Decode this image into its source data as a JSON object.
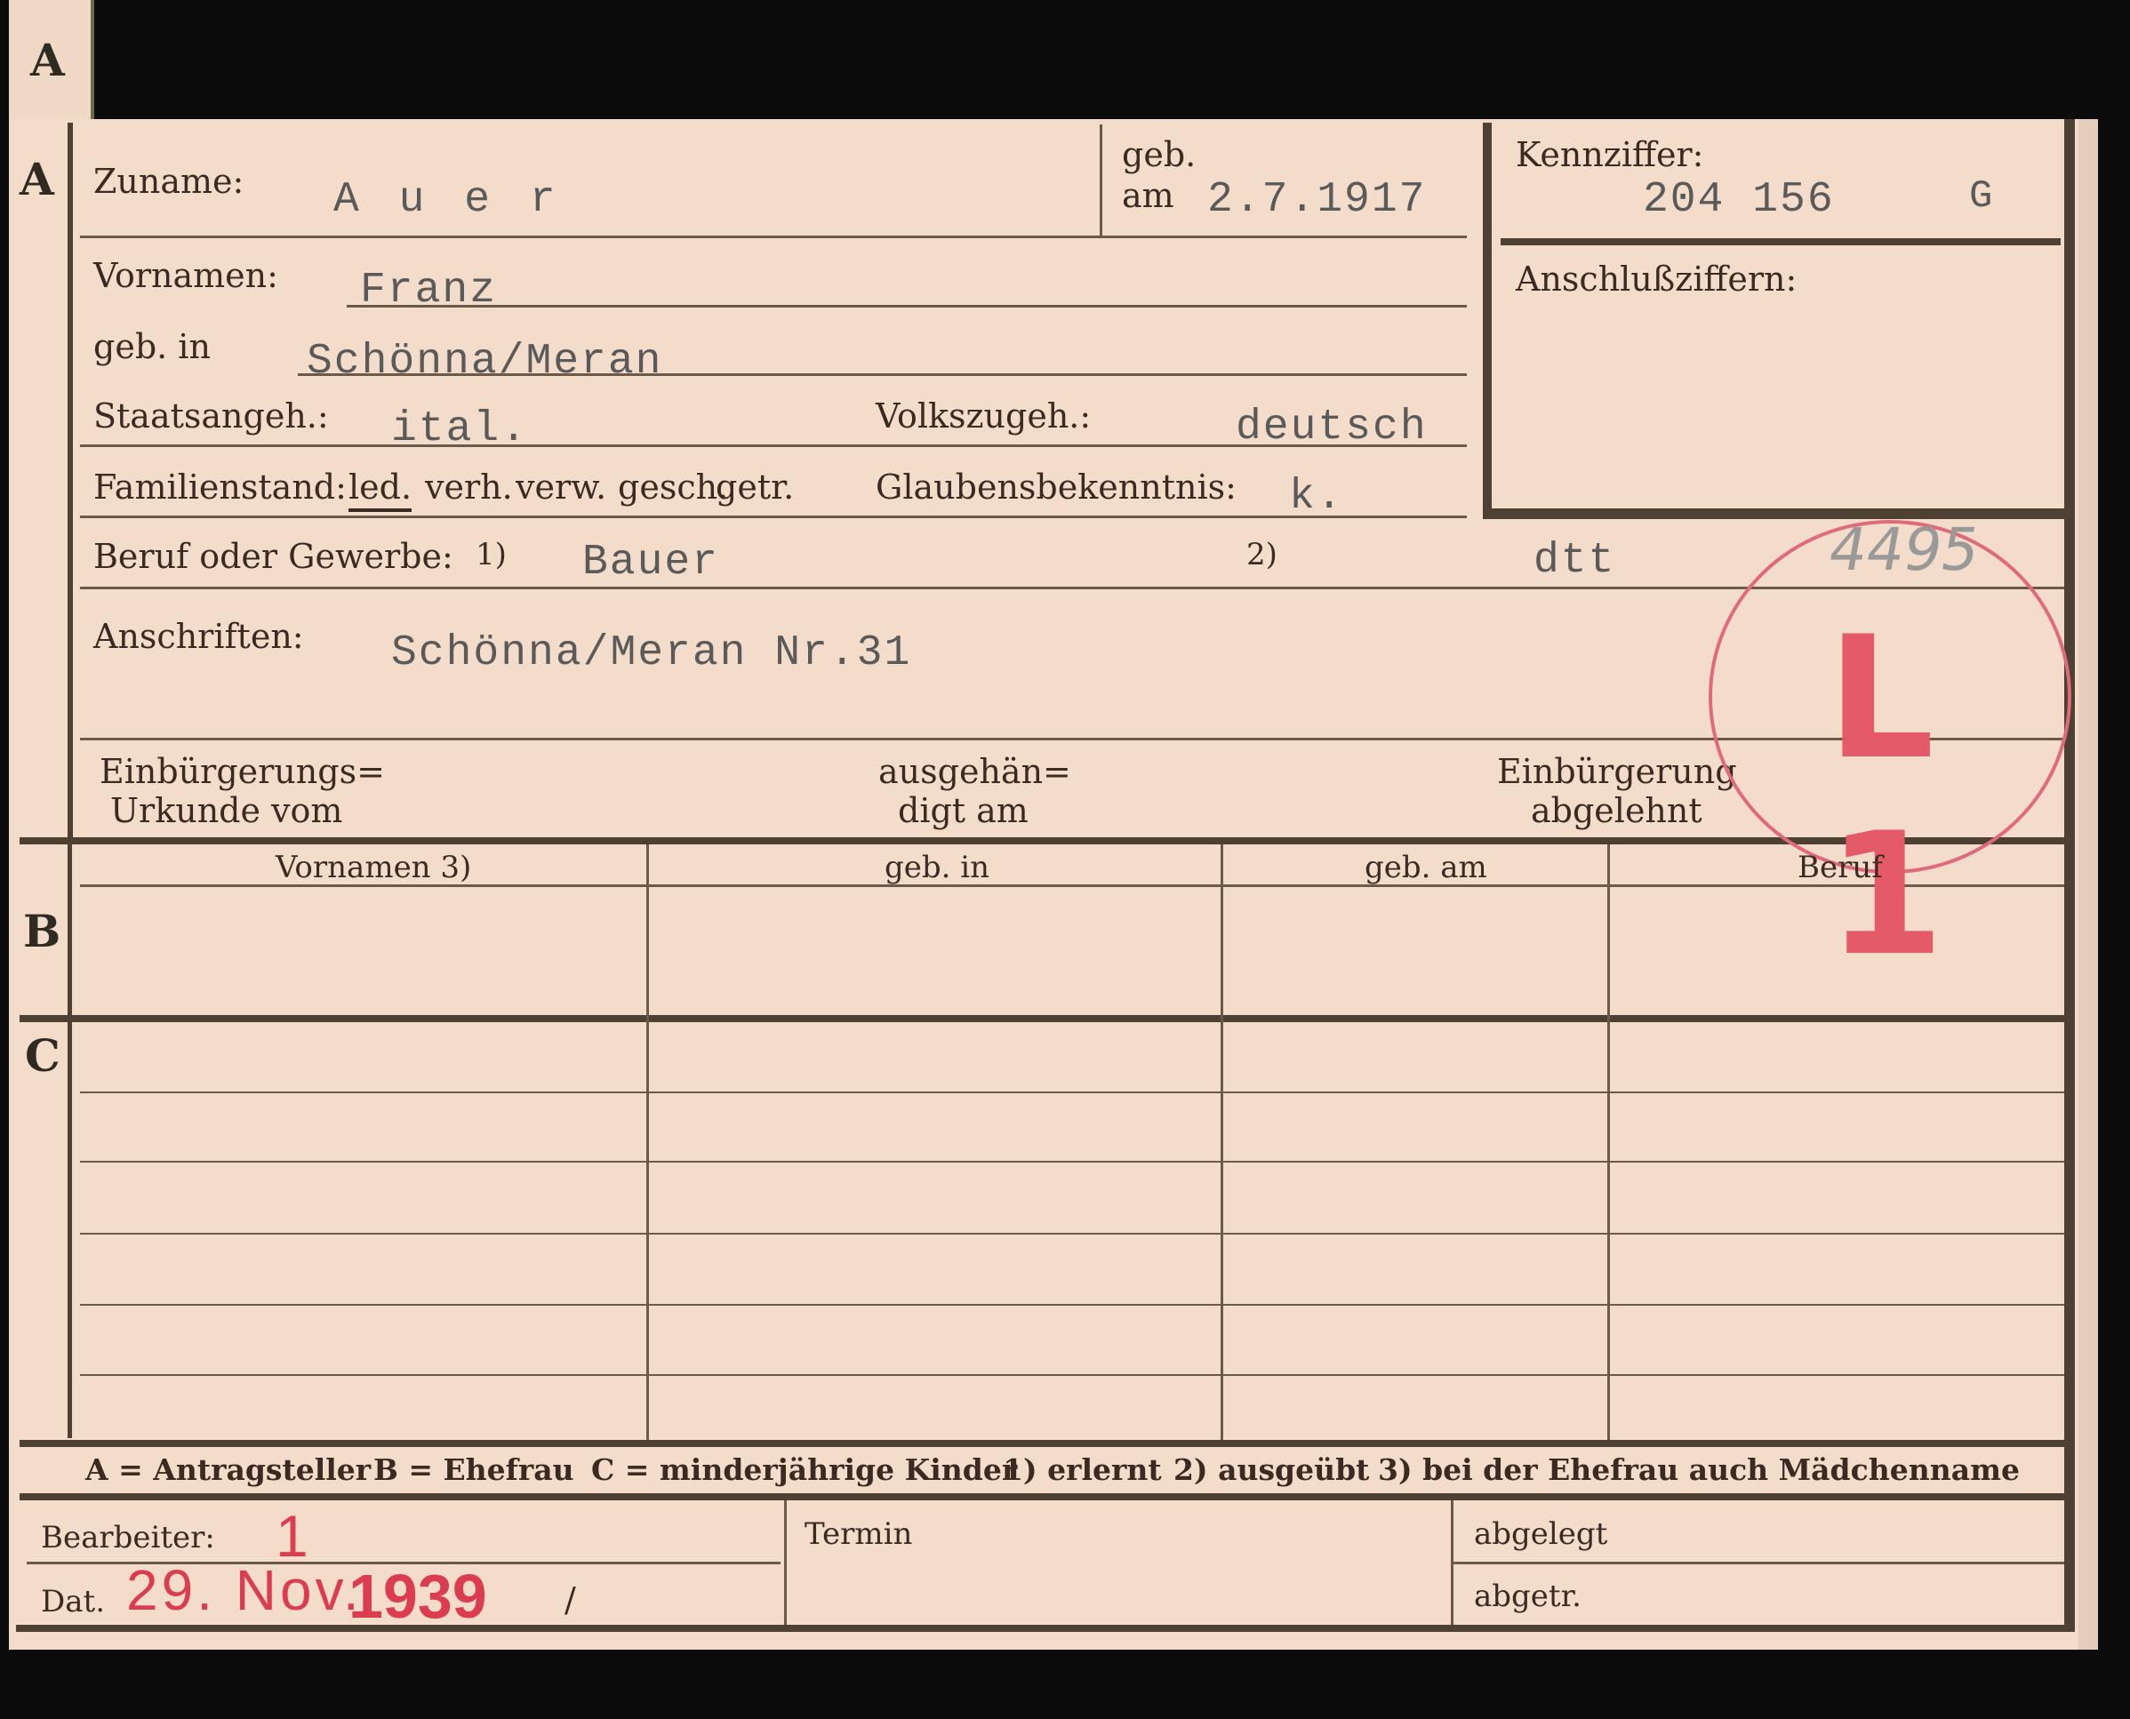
{
  "section_letters": {
    "a": "A",
    "b": "B",
    "c": "C"
  },
  "header": {
    "surname_label": "Zuname:",
    "surname_value": "A u e r",
    "born_on_label_1": "geb.",
    "born_on_label_2": "am",
    "born_on_value": "2.7.1917",
    "id_label": "Kennziffer:",
    "id_value": "204 156",
    "id_suffix": "G",
    "link_numbers_label": "Anschlußziffern:"
  },
  "person": {
    "first_names_label": "Vornamen:",
    "first_names_value": "Franz",
    "birthplace_label": "geb. in",
    "birthplace_value": "Schönna/Meran",
    "citizenship_label": "Staatsangeh.:",
    "citizenship_value": "ital.",
    "ethnicity_label": "Volkszugeh.:",
    "ethnicity_value": "deutsch",
    "marital_label": "Familienstand:",
    "marital_options": [
      "led.",
      "verh.",
      "verw.",
      "gesch.",
      "getr."
    ],
    "religion_label": "Glaubensbekenntnis:",
    "religion_value": "k.",
    "profession_label": "Beruf oder Gewerbe:",
    "profession_note_1": "1)",
    "profession_value": "Bauer",
    "profession_note_2": "2)",
    "profession_value_2": "dtt",
    "address_label": "Anschriften:",
    "address_value": "Schönna/Meran Nr.31",
    "naturalization_certificate_label_1": "Einbürgerungs=",
    "naturalization_certificate_label_2": "Urkunde vom",
    "handed_out_label_1": "ausgehän=",
    "handed_out_label_2": "digt am",
    "naturalization_refused_label_1": "Einbürgerung",
    "naturalization_refused_label_2": "abgelehnt"
  },
  "stamp": {
    "code": "L 1",
    "pencil_number": "4495"
  },
  "table": {
    "columns": [
      "Vornamen 3)",
      "geb. in",
      "geb. am",
      "Beruf"
    ]
  },
  "legend": {
    "a": "A = Antragsteller",
    "b": "B = Ehefrau",
    "c": "C = minderjährige Kinder",
    "n1": "1) erlernt",
    "n2": "2) ausgeübt",
    "n3": "3) bei der Ehefrau auch Mädchenname"
  },
  "footer": {
    "processor_label": "Bearbeiter:",
    "processor_mark": "1",
    "date_label": "Dat.",
    "date_value_day": "29. Nov.",
    "date_value_year": "1939",
    "slash": "/",
    "deadline_label": "Termin",
    "filed_label": "abgelegt",
    "separated_label": "abgetr."
  }
}
